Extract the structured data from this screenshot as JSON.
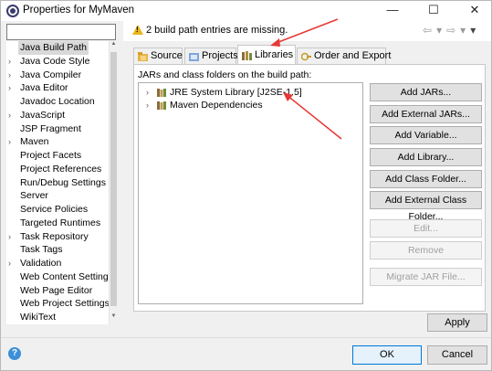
{
  "window": {
    "title": "Properties for MyMaven",
    "minimize_glyph": "—",
    "maximize_glyph": "☐",
    "close_glyph": "✕"
  },
  "sidebar": {
    "filter_value": "",
    "items": [
      {
        "label": "Java Build Path",
        "expandable": false,
        "selected": true
      },
      {
        "label": "Java Code Style",
        "expandable": true
      },
      {
        "label": "Java Compiler",
        "expandable": true
      },
      {
        "label": "Java Editor",
        "expandable": true
      },
      {
        "label": "Javadoc Location",
        "expandable": false
      },
      {
        "label": "JavaScript",
        "expandable": true
      },
      {
        "label": "JSP Fragment",
        "expandable": false
      },
      {
        "label": "Maven",
        "expandable": true
      },
      {
        "label": "Project Facets",
        "expandable": false
      },
      {
        "label": "Project References",
        "expandable": false
      },
      {
        "label": "Run/Debug Settings",
        "expandable": false
      },
      {
        "label": "Server",
        "expandable": false
      },
      {
        "label": "Service Policies",
        "expandable": false
      },
      {
        "label": "Targeted Runtimes",
        "expandable": false
      },
      {
        "label": "Task Repository",
        "expandable": true
      },
      {
        "label": "Task Tags",
        "expandable": false
      },
      {
        "label": "Validation",
        "expandable": true
      },
      {
        "label": "Web Content Settings",
        "expandable": false
      },
      {
        "label": "Web Page Editor",
        "expandable": false
      },
      {
        "label": "Web Project Settings",
        "expandable": false
      },
      {
        "label": "WikiText",
        "expandable": false
      }
    ]
  },
  "header": {
    "message": "2 build path entries are missing.",
    "warning_icon": "warning-icon"
  },
  "tabs": [
    {
      "label": "Source",
      "icon": "source-folder-icon"
    },
    {
      "label": "Projects",
      "icon": "projects-icon"
    },
    {
      "label": "Libraries",
      "icon": "libraries-icon",
      "active": true
    },
    {
      "label": "Order and Export",
      "icon": "order-export-icon"
    }
  ],
  "panel": {
    "label": "JARs and class folders on the build path:",
    "entries": [
      {
        "label": "JRE System Library [J2SE-1.5]"
      },
      {
        "label": "Maven Dependencies"
      }
    ]
  },
  "buttons": {
    "add_jars": "Add JARs...",
    "add_external_jars": "Add External JARs...",
    "add_variable": "Add Variable...",
    "add_library": "Add Library...",
    "add_class_folder": "Add Class Folder...",
    "add_external_class_folder": "Add External Class Folder...",
    "edit": "Edit...",
    "remove": "Remove",
    "migrate_jar": "Migrate JAR File..."
  },
  "footer": {
    "apply": "Apply",
    "ok": "OK",
    "cancel": "Cancel",
    "help_glyph": "?"
  },
  "colors": {
    "annotation_arrow": "#e53935",
    "warning": "#e8b61d",
    "selected_bg": "#d9d9d9"
  }
}
